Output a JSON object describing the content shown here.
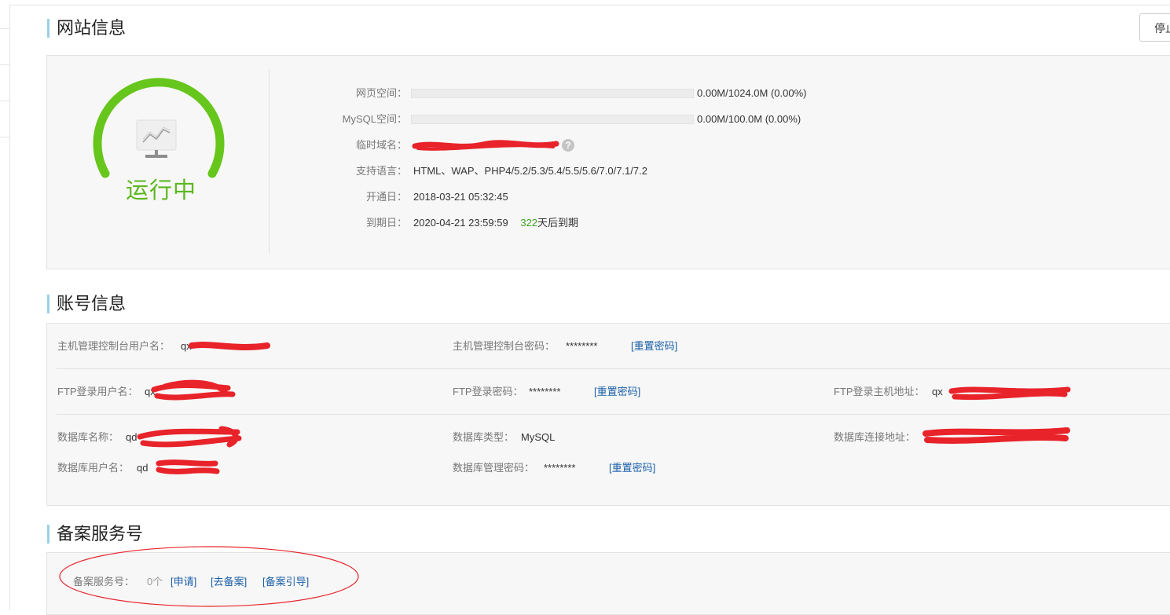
{
  "site_info": {
    "title": "网站信息",
    "stop_button": "停止",
    "status": "运行中",
    "rows": {
      "web_space": {
        "label": "网页空间：",
        "usage": "0.00M/1024.0M (0.00%)",
        "fraction": 0
      },
      "mysql_space": {
        "label": "MySQL空间：",
        "usage": "0.00M/100.0M (0.00%)",
        "fraction": 0
      },
      "temp_domain": {
        "label": "临时域名：",
        "value": ""
      },
      "languages": {
        "label": "支持语言：",
        "value": "HTML、WAP、PHP4/5.2/5.3/5.4/5.5/5.6/7.0/7.1/7.2"
      },
      "open_date": {
        "label": "开通日：",
        "value": "2018-03-21 05:32:45"
      },
      "expire_date": {
        "label": "到期日：",
        "value": "2020-04-21 23:59:59",
        "days_left": "322",
        "days_suffix": "天后到期"
      }
    },
    "help_glyph": "?"
  },
  "account_info": {
    "title": "账号信息",
    "host_user_label": "主机管理控制台用户名：",
    "host_user_value": "qx",
    "host_pwd_label": "主机管理控制台密码：",
    "host_pwd_value": "********",
    "reset_link": "[重置密码]",
    "ftp_user_label": "FTP登录用户名：",
    "ftp_user_value": "qx",
    "ftp_pwd_label": "FTP登录密码：",
    "ftp_pwd_value": "********",
    "ftp_host_label": "FTP登录主机地址：",
    "ftp_host_value": "qx",
    "db_name_label": "数据库名称：",
    "db_name_value": "qd",
    "db_type_label": "数据库类型：",
    "db_type_value": "MySQL",
    "db_addr_label": "数据库连接地址：",
    "db_user_label": "数据库用户名：",
    "db_user_value": "qd",
    "db_pwd_label": "数据库管理密码：",
    "db_pwd_value": "********"
  },
  "beian": {
    "title": "备案服务号",
    "label": "备案服务号：",
    "count": "0个",
    "apply_link": "[申请]",
    "go_link": "[去备案]",
    "guide_link": "[备案引导]"
  },
  "colors": {
    "accent_green": "#5cb81e",
    "link_blue": "#1a5fa8",
    "annotation_red": "#e8232a"
  },
  "icons": {
    "status": "monitor-chart-icon",
    "help": "question-circle-icon"
  }
}
